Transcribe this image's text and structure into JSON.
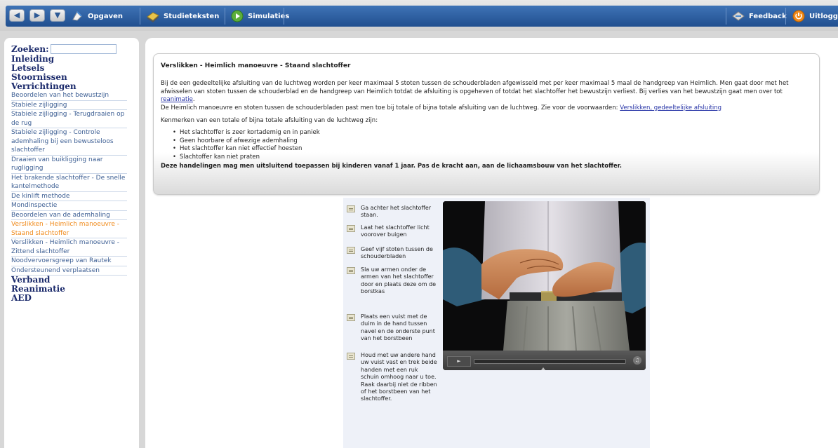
{
  "toolbar": {
    "back_icon": "back-arrow-icon",
    "forward_icon": "forward-arrow-icon",
    "dropdown_icon": "chevron-down-icon",
    "items": [
      {
        "label": "Opgaven",
        "icon": "tasks-icon"
      },
      {
        "label": "Studieteksten",
        "icon": "book-icon"
      },
      {
        "label": "Simulaties",
        "icon": "play-icon"
      }
    ],
    "feedback_label": "Feedback",
    "logout_label": "Uitlogge",
    "accent_color": "#2f5fa2"
  },
  "sidebar": {
    "search_label": "Zoeken:",
    "search_value": "",
    "menu": [
      {
        "label": "Inleiding",
        "level": "top"
      },
      {
        "label": "Letsels",
        "level": "top"
      },
      {
        "label": "Stoornissen",
        "level": "top"
      },
      {
        "label": "Verrichtingen",
        "level": "top"
      },
      {
        "label": "Beoordelen van het bewustzijn",
        "level": "sub"
      },
      {
        "label": "Stabiele zijligging",
        "level": "sub"
      },
      {
        "label": "Stabiele zijligging - Terugdraaien op de rug",
        "level": "sub"
      },
      {
        "label": "Stabiele zijligging - Controle ademhaling bij een bewusteloos slachtoffer",
        "level": "sub"
      },
      {
        "label": "Draaien van buikligging naar rugligging",
        "level": "sub"
      },
      {
        "label": "Het brakende slachtoffer - De snelle kantelmethode",
        "level": "sub"
      },
      {
        "label": "De kinlift methode",
        "level": "sub"
      },
      {
        "label": "Mondinspectie",
        "level": "sub"
      },
      {
        "label": "Beoordelen van de ademhaling",
        "level": "sub"
      },
      {
        "label": "Verslikken - Heimlich manoeuvre - Staand slachtoffer",
        "level": "sub",
        "active": true
      },
      {
        "label": "Verslikken - Heimlich manoeuvre - Zittend slachtoffer",
        "level": "sub"
      },
      {
        "label": "Noodvervoersgreep van Rautek",
        "level": "sub"
      },
      {
        "label": "Ondersteunend verplaatsen",
        "level": "sub"
      },
      {
        "label": "Verband",
        "level": "top"
      },
      {
        "label": "Reanimatie",
        "level": "top"
      },
      {
        "label": "AED",
        "level": "top"
      }
    ],
    "active_color": "#f08a1a"
  },
  "article": {
    "title": "Verslikken - Heimlich manoeuvre - Staand slachtoffer",
    "p1": "Bij de een gedeeltelijke afsluiting van de luchtweg worden per keer maximaal 5 stoten tussen de schouderbladen afgewisseld met per keer maximaal 5 maal de handgreep van Heimlich. Men gaat door met het afwisselen van stoten tussen de schouderblad en de handgreep van Heimlich totdat de afsluiting is opgeheven of totdat het slachtoffer het bewustzijn verliest. Bij verlies van het bewustzijn gaat men over tot ",
    "p1_link": "reanimatie",
    "p1_end": ".",
    "p2": "De Heimlich manoeuvre en stoten tussen de schouderbladen past men toe bij totale of bijna totale afsluiting van de luchtweg. Zie voor de voorwaarden: ",
    "p2_link": "Verslikken, gedeeltelijke afsluiting",
    "p3": "Kenmerken van een totale of bijna totale afsluiting van de luchtweg zijn:",
    "bullets": [
      "Het slachtoffer is zeer kortademig en in paniek",
      "Geen hoorbare of afwezige ademhaling",
      "Het slachtoffer kan niet effectief hoesten",
      "Slachtoffer kan niet praten"
    ],
    "note": "Deze handelingen mag men uitsluitend toepassen bij kinderen vanaf 1 jaar. Pas de kracht aan, aan de lichaamsbouw van het slachtoffer."
  },
  "steps": [
    "Ga achter het slachtoffer staan.",
    "Laat het slachtoffer licht voorover buigen",
    "Geef vijf stoten tussen de schouderbladen",
    "Sla uw armen onder de armen van het slachtoffer door en plaats deze om de borstkas",
    "Plaats een vuist met de duim in de hand tussen navel en de onderste punt van het borstbeen",
    "Houd met uw andere hand uw vuist vast en trek beide handen met een ruk schuin omhoog naar u toe. Raak daarbij niet de ribben of het borstbeen van het slachtoffer."
  ],
  "video": {
    "play_icon": "play-icon",
    "volume_icon": "volume-icon",
    "progress": 0
  }
}
